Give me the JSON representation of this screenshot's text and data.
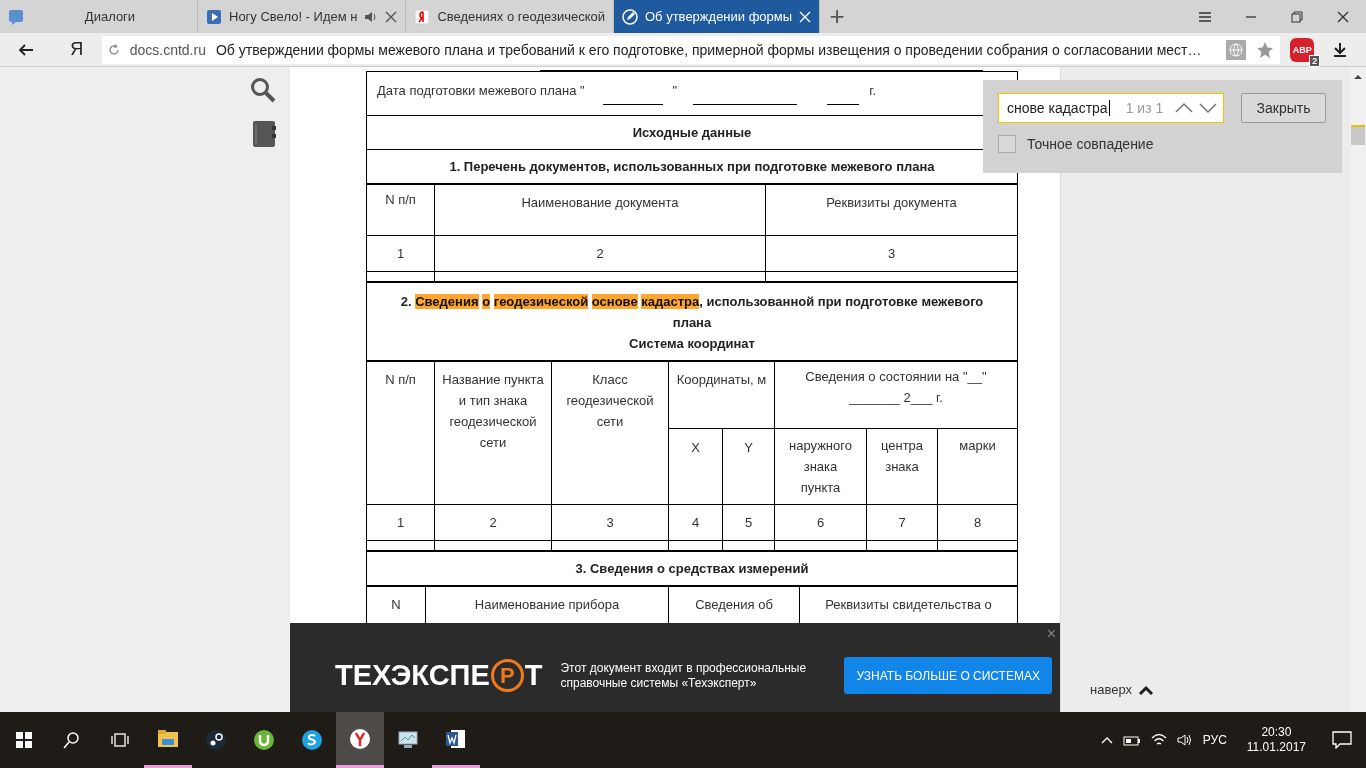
{
  "browser": {
    "tabs": [
      {
        "title": "Диалоги",
        "kind": "messages",
        "selected": false,
        "audio": false
      },
      {
        "title": "Ногу Свело! - Идем н",
        "kind": "video",
        "selected": false,
        "audio": true
      },
      {
        "title": "Сведениях о геодезической",
        "kind": "yandex",
        "selected": false,
        "audio": false
      },
      {
        "title": "Об утверждении формы",
        "kind": "doc",
        "selected": true,
        "audio": false
      }
    ],
    "new_tab": "+",
    "address": {
      "domain": "docs.cntd.ru",
      "title": "Об утверждении формы межевого плана и требований к его подготовке, примерной формы извещения о проведении собрания о согласовании мест…"
    },
    "yandex_button": "Я",
    "adblock": {
      "label": "ABP",
      "count": "2"
    }
  },
  "find_bar": {
    "value": "снове кадастра",
    "counter": "1 из 1",
    "close": "Закрыть",
    "exact_match": {
      "label": "Точное совпадение",
      "checked": false
    }
  },
  "document": {
    "date_line": {
      "label": "Дата подготовки межевого плана \"",
      "quote": "\"",
      "year": "г."
    },
    "heading": "Исходные данные",
    "section_1": {
      "title": "1. Перечень документов, использованных при подготовке межевого плана",
      "columns": [
        "N п/п",
        "Наименование документа",
        "Реквизиты документа"
      ],
      "numbers": [
        "1",
        "2",
        "3"
      ]
    },
    "section_2": {
      "title_prefix": "2. ",
      "title_match": {
        "text": "Сведения о геодезической основе кадастра",
        "highlighted": true
      },
      "title_rest": ", использованной при подготовке межевого плана",
      "subtitle": "Система координат",
      "header": {
        "number": "N п/п",
        "point_name": "Название пункта и тип знака геодезической сети",
        "network_class": "Класс геодезической сети",
        "coordinates": "Координаты, м",
        "x": "X",
        "y": "Y",
        "state": "Сведения о состоянии на \"__\" _______ 2___ г.",
        "state_columns": [
          "наружного знака пункта",
          "центра знака",
          "марки"
        ]
      },
      "numbers": [
        "1",
        "2",
        "3",
        "4",
        "5",
        "6",
        "7",
        "8"
      ]
    },
    "section_3": {
      "title": "3. Сведения о средствах измерений",
      "columns": [
        "N",
        "Наименование прибора",
        "Сведения об",
        "Реквизиты свидетельства о"
      ]
    }
  },
  "banner": {
    "logo": {
      "before": "ТЕХЭКСПЕ",
      "mark": "Р",
      "after": "Т"
    },
    "text": "Этот документ входит в профессиональные справочные системы «Техэксперт»",
    "button": "УЗНАТЬ БОЛЬШЕ О СИСТЕМАХ",
    "close": "×"
  },
  "to_top": "наверх",
  "taskbar": {
    "apps": [
      {
        "kind": "explorer",
        "active": false,
        "running": true
      },
      {
        "kind": "steam",
        "active": false,
        "running": false
      },
      {
        "kind": "torrent",
        "active": false,
        "running": false
      },
      {
        "kind": "skype",
        "active": false,
        "running": false
      },
      {
        "kind": "yandex",
        "active": true,
        "running": true
      },
      {
        "kind": "monitor",
        "active": false,
        "running": false
      },
      {
        "kind": "word",
        "active": false,
        "running": true
      }
    ],
    "language": "РУС",
    "time": "20:30",
    "date": "11.01.2017"
  }
}
